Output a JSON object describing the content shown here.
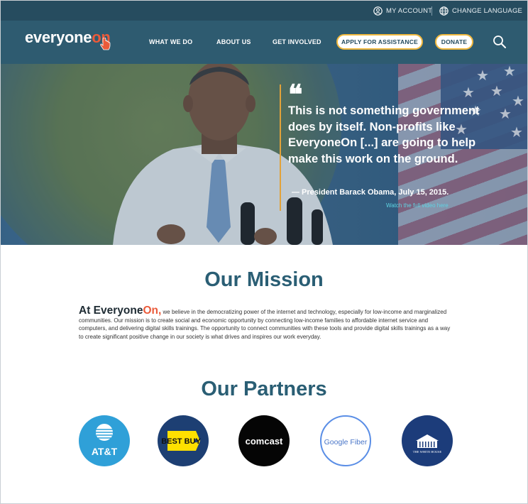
{
  "utility": {
    "account_label": "MY ACCOUNT",
    "language_label": "CHANGE LANGUAGE"
  },
  "nav": {
    "logo_main": "everyone",
    "logo_accent": "on",
    "links": [
      "WHAT WE DO",
      "ABOUT US",
      "GET INVOLVED"
    ],
    "apply_label": "APPLY FOR ASSISTANCE",
    "donate_label": "DONATE"
  },
  "hero": {
    "quote": "This is not something government does by itself. Non-profits like EveryoneOn [...] are going to help make this work on the ground.",
    "attribution": "— President Barack Obama, July 15, 2015.",
    "watch_link": "Watch the full video here"
  },
  "mission": {
    "title": "Our Mission",
    "lead_prefix": "At Everyone",
    "lead_accent": "On,",
    "body": "we believe in the democratizing power of the internet and technology, especially for low-income and marginalized communities. Our mission is to create social and economic opportunity by connecting low-income families to affordable internet service and computers, and delivering digital skills trainings. The opportunity to connect communities with these tools and provide digital skills trainings as a way to create significant positive change in our society is what drives and inspires our work everyday."
  },
  "partners": {
    "title": "Our Partners",
    "logos": [
      {
        "name": "AT&T",
        "text": "AT&T",
        "bg": "#2fa0d8"
      },
      {
        "name": "Best Buy",
        "text": "BEST BUY",
        "bg": "#1d3f73"
      },
      {
        "name": "Comcast",
        "text": "comcast",
        "bg": "#050505"
      },
      {
        "name": "Google Fiber",
        "text": "Google Fiber",
        "bg": "#ffffff"
      },
      {
        "name": "The White House",
        "text": "THE WHITE HOUSE",
        "bg": "#1c3c7a"
      }
    ]
  },
  "colors": {
    "utility_bg": "#264c5f",
    "nav_bg": "#2e5b70",
    "heading": "#2a5e74",
    "accent_orange": "#ea5a3a",
    "pill_border": "#f1b93f",
    "link_cyan": "#5fd3e2"
  }
}
